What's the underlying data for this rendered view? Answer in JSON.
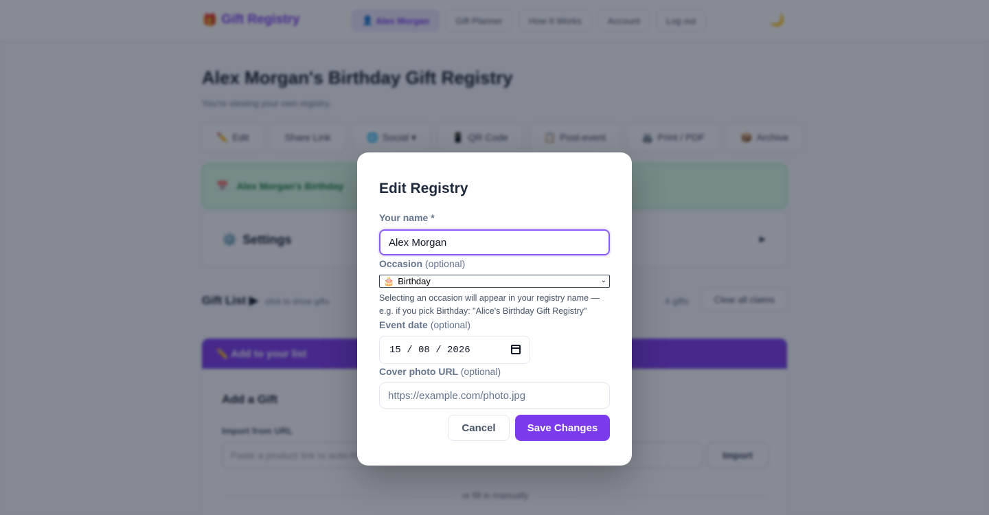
{
  "header": {
    "brand": "Gift Registry",
    "brand_icon": "🎁",
    "nav": [
      {
        "icon": "👤",
        "label": "Alex Morgan"
      },
      {
        "label": "Gift Planner"
      },
      {
        "label": "How It Works"
      },
      {
        "label": "Account"
      },
      {
        "label": "Log out"
      }
    ],
    "theme_icon": "🌙"
  },
  "page": {
    "title": "Alex Morgan's Birthday Gift Registry",
    "subtitle": "You're viewing your own registry.",
    "actions": [
      {
        "icon": "✏️",
        "label": "Edit"
      },
      {
        "icon": "",
        "label": "Share Link"
      },
      {
        "icon": "🌐",
        "label": "Social ▾"
      },
      {
        "icon": "📱",
        "label": "QR Code"
      },
      {
        "icon": "📋",
        "label": "Post-event"
      },
      {
        "icon": "🖨️",
        "label": "Print / PDF"
      },
      {
        "icon": "📦",
        "label": "Archive"
      }
    ],
    "banner_icon": "📅",
    "banner_text": "Alex Morgan's Birthday",
    "settings_title": "Settings",
    "settings_icon": "⚙️",
    "settings_arrow": "▶",
    "gift_list_title": "Gift List ▶",
    "gift_list_hint": "click to show gifts",
    "gift_count": "4 gifts",
    "clear_claims": "Clear all claims",
    "add_bar": "✏️ Add to your list",
    "add_gift_title": "Add a Gift",
    "import_label": "Import from URL",
    "import_placeholder": "Paste a product link to auto-fill",
    "import_button": "Import",
    "or_text": "or fill in manually"
  },
  "modal": {
    "title": "Edit Registry",
    "name_label": "Your name *",
    "name_value": "Alex Morgan",
    "occasion_label": "Occasion",
    "optional": "(optional)",
    "occasion_icon": "🎂",
    "occasion_value": "Birthday",
    "occasion_help": "Selecting an occasion will appear in your registry name — e.g. if you pick Birthday: \"Alice's Birthday Gift Registry\"",
    "date_label": "Event date",
    "date_value": "15 / 08 / 2026",
    "cover_label": "Cover photo URL",
    "cover_placeholder": "https://example.com/photo.jpg",
    "cancel": "Cancel",
    "save": "Save Changes"
  }
}
